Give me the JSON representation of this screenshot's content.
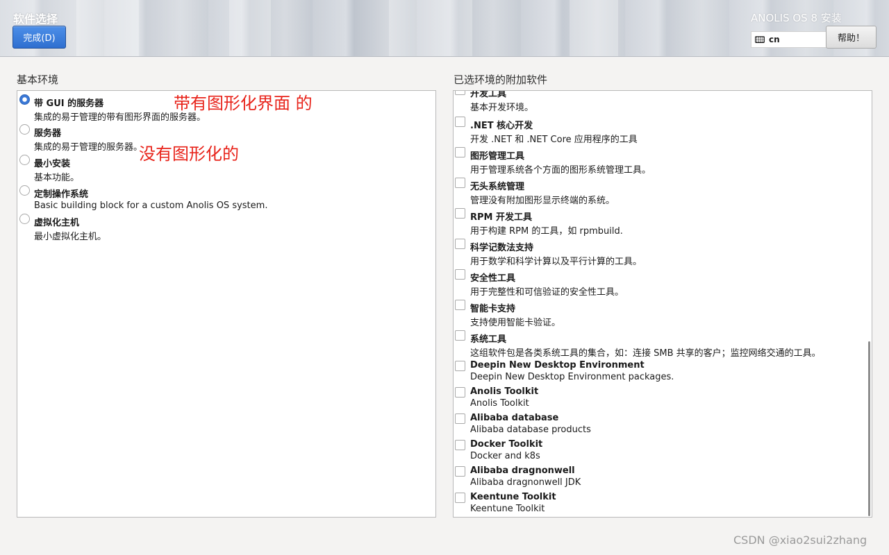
{
  "header": {
    "page_title": "软件选择",
    "done_label": "完成(D)",
    "os_title": "ANOLIS OS 8 安装",
    "keyboard_layout": "cn",
    "help_label": "帮助！"
  },
  "left": {
    "heading": "基本环境",
    "selected_index": 0,
    "items": [
      {
        "title": "带 GUI 的服务器",
        "desc": "集成的易于管理的带有图形界面的服务器。",
        "selected": true
      },
      {
        "title": "服务器",
        "desc": "集成的易于管理的服务器。",
        "selected": false
      },
      {
        "title": "最小安装",
        "desc": "基本功能。",
        "selected": false
      },
      {
        "title": "定制操作系统",
        "desc": "Basic building block for a custom Anolis OS system.",
        "selected": false
      },
      {
        "title": "虚拟化主机",
        "desc": "最小虚拟化主机。",
        "selected": false
      }
    ]
  },
  "right": {
    "heading": "已选环境的附加软件",
    "items": [
      {
        "title": "开发工具",
        "desc": "基本开发环境。",
        "checked": false
      },
      {
        "title": ".NET 核心开发",
        "desc": "开发 .NET 和 .NET Core 应用程序的工具",
        "checked": false
      },
      {
        "title": "图形管理工具",
        "desc": "用于管理系统各个方面的图形系统管理工具。",
        "checked": false
      },
      {
        "title": "无头系统管理",
        "desc": "管理没有附加图形显示终端的系统。",
        "checked": false
      },
      {
        "title": "RPM 开发工具",
        "desc": "用于构建 RPM 的工具，如 rpmbuild.",
        "checked": false
      },
      {
        "title": "科学记数法支持",
        "desc": "用于数学和科学计算以及平行计算的工具。",
        "checked": false
      },
      {
        "title": "安全性工具",
        "desc": "用于完整性和可信验证的安全性工具。",
        "checked": false
      },
      {
        "title": "智能卡支持",
        "desc": "支持使用智能卡验证。",
        "checked": false
      },
      {
        "title": "系统工具",
        "desc": "这组软件包是各类系统工具的集合，如：连接 SMB 共享的客户；监控网络交通的工具。",
        "checked": false
      },
      {
        "title": "Deepin New Desktop Environment",
        "desc": "Deepin New Desktop Environment packages.",
        "checked": false
      },
      {
        "title": "Anolis Toolkit",
        "desc": "Anolis Toolkit",
        "checked": false
      },
      {
        "title": "Alibaba database",
        "desc": "Alibaba database products",
        "checked": false
      },
      {
        "title": "Docker Toolkit",
        "desc": "Docker and k8s",
        "checked": false
      },
      {
        "title": "Alibaba dragnonwell",
        "desc": "Alibaba dragnonwell JDK",
        "checked": false
      },
      {
        "title": "Keentune Toolkit",
        "desc": "Keentune Toolkit",
        "checked": false
      }
    ]
  },
  "annotations": {
    "gui_note": "带有图形化界面 的",
    "no_gui_note": "没有图形化的"
  },
  "watermark": "CSDN @xiao2sui2zhang",
  "colors": {
    "accent": "#3a78d6",
    "annotation": "#e8231a"
  }
}
